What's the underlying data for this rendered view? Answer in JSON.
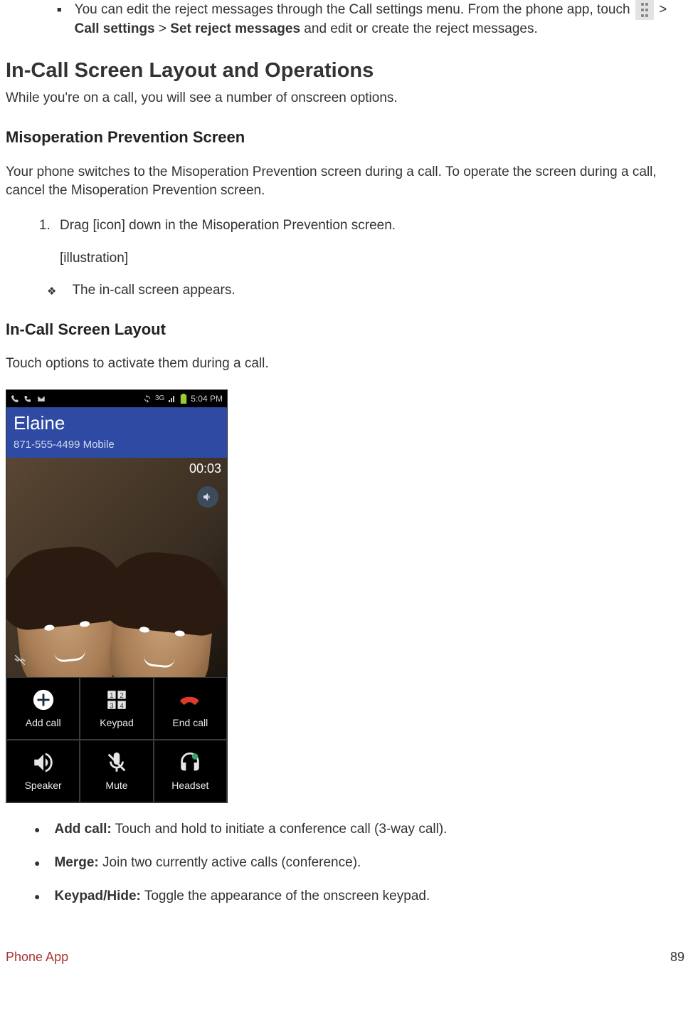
{
  "tip": {
    "line1": "You can edit the reject messages through the Call settings menu. From the phone app, touch",
    "gt1": " > ",
    "bold1": "Call settings",
    "gt2": " > ",
    "bold2": "Set reject messages",
    "tail": " and edit or create the reject messages."
  },
  "h1": "In-Call Screen Layout and Operations",
  "intro": "While you're on a call, you will see a number of onscreen options.",
  "misop": {
    "h2": "Misoperation Prevention Screen",
    "body": "Your phone switches to the Misoperation Prevention screen during a call. To operate the screen during a call, cancel the Misoperation Prevention screen.",
    "step1": "Drag [icon] down in the Misoperation Prevention screen.",
    "illus": "[illustration]",
    "result": "The in-call screen appears."
  },
  "layout": {
    "h2": "In-Call Screen Layout",
    "body": "Touch options to activate them during a call."
  },
  "phone": {
    "status_time": "5:04 PM",
    "status_net": "3G",
    "caller_name": "Elaine",
    "caller_line": "871-555-4499   Mobile",
    "timer": "00:03",
    "btn_addcall": "Add call",
    "btn_keypad": "Keypad",
    "btn_endcall": "End call",
    "btn_speaker": "Speaker",
    "btn_mute": "Mute",
    "btn_headset": "Headset"
  },
  "bullets": {
    "addcall_k": "Add call:",
    "addcall_v": " Touch and hold to initiate a conference call (3-way call).",
    "merge_k": "Merge:",
    "merge_v": " Join two currently active calls (conference).",
    "keypad_k": "Keypad/Hide:",
    "keypad_v": " Toggle the appearance of the onscreen keypad."
  },
  "footer": {
    "section": "Phone App",
    "page": "89"
  }
}
